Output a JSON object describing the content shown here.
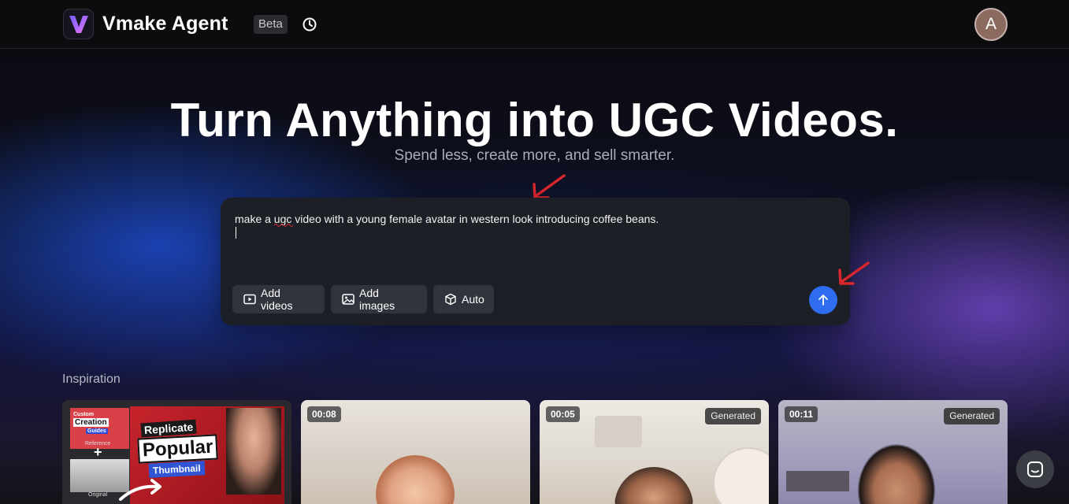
{
  "header": {
    "brand": "Vmake Agent",
    "badge": "Beta",
    "avatar_initial": "A"
  },
  "hero": {
    "title": "Turn Anything into UGC Videos.",
    "subtitle": "Spend less, create more, and sell smarter."
  },
  "prompt": {
    "text": "make a ugc video with a young female avatar in western look introducing coffee beans.",
    "chips": [
      {
        "label": "Add videos",
        "icon": "video-icon"
      },
      {
        "label": "Add images",
        "icon": "image-icon"
      },
      {
        "label": "Auto",
        "icon": "cube-icon"
      }
    ]
  },
  "inspiration": {
    "title": "Inspiration",
    "cards": [
      {
        "type": "thumbnail",
        "labels": {
          "custom": "Custom",
          "creation": "Creation",
          "guides": "Guides",
          "reference": "Reference",
          "plus": "+",
          "original": "Original",
          "replicate": "Replicate",
          "popular": "Popular",
          "thumbnail": "Thumbnail"
        }
      },
      {
        "duration": "00:08",
        "badge": ""
      },
      {
        "duration": "00:05",
        "badge": "Generated"
      },
      {
        "duration": "00:11",
        "badge": "Generated"
      }
    ]
  },
  "colors": {
    "accent": "#2f6cf0",
    "annotation": "#d8262e"
  }
}
